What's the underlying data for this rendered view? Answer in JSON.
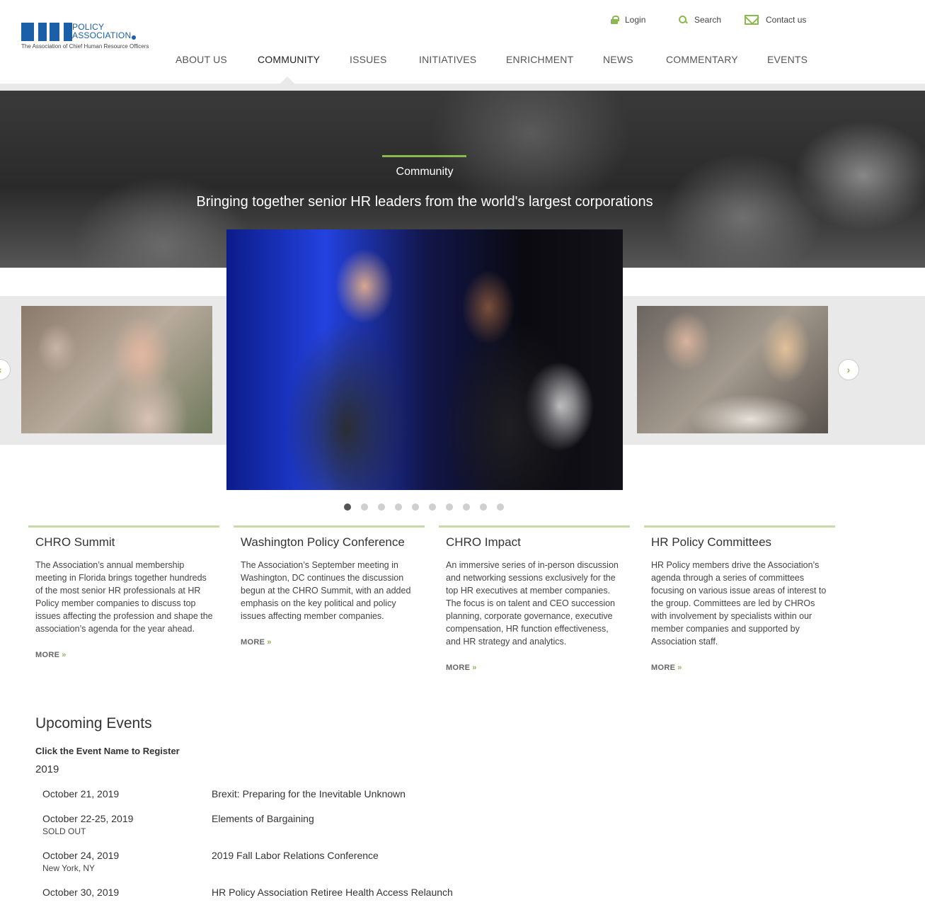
{
  "logo": {
    "line1": "POLICY",
    "line2": "ASSOCIATION",
    "tagline": "The Association of Chief Human Resource Officers"
  },
  "utility_nav": {
    "login": "Login",
    "search": "Search",
    "contact": "Contact us"
  },
  "main_nav": [
    "ABOUT US",
    "COMMUNITY",
    "ISSUES",
    "INITIATIVES",
    "ENRICHMENT",
    "NEWS",
    "COMMENTARY",
    "EVENTS"
  ],
  "active_nav": "COMMUNITY",
  "hero": {
    "kicker": "Community",
    "headline": "Bringing together senior HR leaders from the world's largest corporations"
  },
  "carousel": {
    "slide_count": 10,
    "active_index": 0
  },
  "cards": [
    {
      "title": "CHRO Summit",
      "body": "The Association’s annual membership meeting in Florida brings together hundreds of the most senior HR professionals at HR Policy member companies to discuss top issues affecting the profession and shape the association’s agenda for the year ahead.",
      "more": "MORE"
    },
    {
      "title": "Washington Policy Conference",
      "body": "The Association’s September meeting in Washington, DC continues the discussion begun at the CHRO Summit, with an added emphasis on the key political and policy issues affecting member companies.",
      "more": "MORE"
    },
    {
      "title": "CHRO Impact",
      "body": "An immersive series of in-person discussion and networking sessions exclusively for the top HR executives at member companies. The focus is on talent and CEO succession planning, corporate governance, executive compensation, HR function effectiveness, and HR strategy and analytics.",
      "more": "MORE"
    },
    {
      "title": "HR Policy Committees",
      "body": "HR Policy members drive the Association’s agenda through a series of committees focusing on various issue areas of interest to the group. Committees are led by CHROs with involvement by specialists within our member companies and supported by Association staff.",
      "more": "MORE"
    }
  ],
  "events": {
    "title": "Upcoming Events",
    "subtitle": "Click the Event Name to Register",
    "year": "2019",
    "items": [
      {
        "date": "October 21, 2019",
        "note": "",
        "name": "Brexit: Preparing for the Inevitable Unknown"
      },
      {
        "date": "October 22-25, 2019",
        "note": "SOLD OUT",
        "name": "Elements of Bargaining"
      },
      {
        "date": "October 24, 2019",
        "note": "New York, NY",
        "name": "2019 Fall Labor Relations Conference"
      },
      {
        "date": "October 30, 2019",
        "note": "",
        "name": "HR Policy Association Retiree Health Access Relaunch"
      }
    ]
  },
  "colors": {
    "brand_blue": "#1a5fa8",
    "accent_green": "#8cb84f",
    "card_rule": "#c7dba8"
  }
}
